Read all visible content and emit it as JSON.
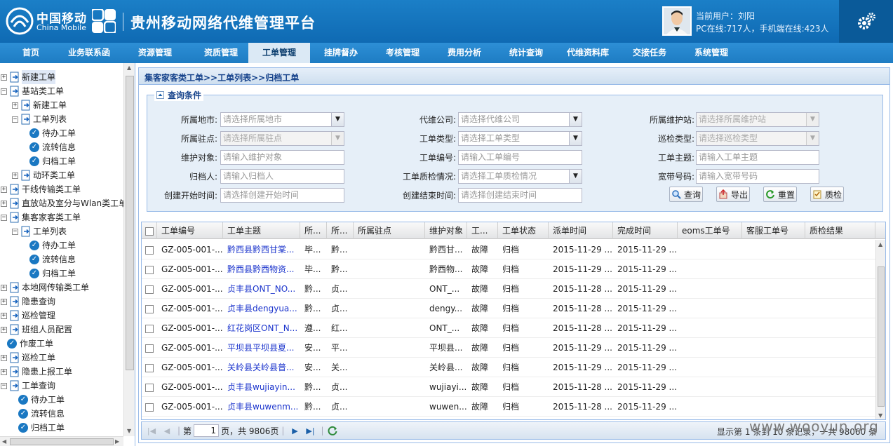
{
  "header": {
    "brand_cn": "中国移动",
    "brand_en": "China Mobile",
    "app_title": "贵州移动网络代维管理平台",
    "user_line1": "当前用户：刘阳",
    "user_line2": "PC在线:717人，手机端在线:423人"
  },
  "nav": [
    {
      "label": "首页"
    },
    {
      "label": "业务联系函"
    },
    {
      "label": "资源管理"
    },
    {
      "label": "资质管理"
    },
    {
      "label": "工单管理"
    },
    {
      "label": "挂牌督办"
    },
    {
      "label": "考核管理"
    },
    {
      "label": "费用分析"
    },
    {
      "label": "统计查询"
    },
    {
      "label": "代维资料库"
    },
    {
      "label": "交接任务"
    },
    {
      "label": "系统管理"
    }
  ],
  "tree": [
    {
      "label": "新建工单"
    },
    {
      "label": "基站类工单"
    },
    {
      "label": "新建工单"
    },
    {
      "label": "工单列表"
    },
    {
      "label": "待办工单"
    },
    {
      "label": "流转信息"
    },
    {
      "label": "归档工单"
    },
    {
      "label": "动环类工单"
    },
    {
      "label": "干线传输类工单"
    },
    {
      "label": "直放站及室分与Wlan类工单"
    },
    {
      "label": "集客家客类工单"
    },
    {
      "label": "工单列表"
    },
    {
      "label": "待办工单"
    },
    {
      "label": "流转信息"
    },
    {
      "label": "归档工单"
    },
    {
      "label": "本地网传输类工单"
    },
    {
      "label": "隐患查询"
    },
    {
      "label": "巡检管理"
    },
    {
      "label": "班组人员配置"
    },
    {
      "label": "作废工单"
    },
    {
      "label": "巡检工单"
    },
    {
      "label": "隐患上报工单"
    },
    {
      "label": "工单查询"
    },
    {
      "label": "待办工单"
    },
    {
      "label": "流转信息"
    },
    {
      "label": "归档工单"
    }
  ],
  "breadcrumb": "集客家客类工单>>工单列表>>归档工单",
  "query": {
    "title": "查询条件",
    "fields": [
      {
        "label": "所属地市:",
        "placeholder": "请选择所属地市"
      },
      {
        "label": "代维公司:",
        "placeholder": "请选择代维公司"
      },
      {
        "label": "所属维护站:",
        "placeholder": "请选择所属维护站"
      },
      {
        "label": "所属驻点:",
        "placeholder": "请选择所属驻点"
      },
      {
        "label": "工单类型:",
        "placeholder": "请选择工单类型"
      },
      {
        "label": "巡检类型:",
        "placeholder": "请选择巡检类型"
      },
      {
        "label": "维护对象:",
        "placeholder": "请输入维护对象"
      },
      {
        "label": "工单编号:",
        "placeholder": "请输入工单编号"
      },
      {
        "label": "工单主题:",
        "placeholder": "请输入工单主题"
      },
      {
        "label": "归档人:",
        "placeholder": "请输入归档人"
      },
      {
        "label": "工单质检情况:",
        "placeholder": "请选择工单质检情况"
      },
      {
        "label": "宽带号码:",
        "placeholder": "请输入宽带号码"
      },
      {
        "label": "创建开始时间:",
        "placeholder": "请选择创建开始时间"
      },
      {
        "label": "创建结束时间:",
        "placeholder": "请选择创建结束时间"
      }
    ],
    "buttons": {
      "search": "查询",
      "export": "导出",
      "reset": "重置",
      "qc": "质检"
    }
  },
  "grid": {
    "columns": [
      "工单编号",
      "工单主题",
      "所...",
      "所...",
      "所属驻点",
      "维护对象",
      "工...",
      "工单状态",
      "派单时间",
      "完成时间",
      "eoms工单号",
      "客服工单号",
      "质检结果"
    ],
    "rows": [
      [
        "GZ-005-001-...",
        "黔西县黔西甘棠...",
        "毕...",
        "黔...",
        "",
        "黔西甘...",
        "故障",
        "归档",
        "2015-11-29 ...",
        "2015-11-29 ...",
        "",
        "",
        ""
      ],
      [
        "GZ-005-001-...",
        "黔西县黔西物资...",
        "毕...",
        "黔...",
        "",
        "黔西物...",
        "故障",
        "归档",
        "2015-11-29 ...",
        "2015-11-29 ...",
        "",
        "",
        ""
      ],
      [
        "GZ-005-001-...",
        "贞丰县ONT_NO...",
        "黔...",
        "贞...",
        "",
        "ONT_...",
        "故障",
        "归档",
        "2015-11-28 ...",
        "2015-11-29 ...",
        "",
        "",
        ""
      ],
      [
        "GZ-005-001-...",
        "贞丰县dengyua...",
        "黔...",
        "贞...",
        "",
        "dengy...",
        "故障",
        "归档",
        "2015-11-28 ...",
        "2015-11-29 ...",
        "",
        "",
        ""
      ],
      [
        "GZ-005-001-...",
        "红花岗区ONT_N...",
        "遵...",
        "红...",
        "",
        "ONT_...",
        "故障",
        "归档",
        "2015-11-28 ...",
        "2015-11-29 ...",
        "",
        "",
        ""
      ],
      [
        "GZ-005-001-...",
        "平坝县平坝县夏...",
        "安...",
        "平...",
        "",
        "平坝县...",
        "故障",
        "归档",
        "2015-11-29 ...",
        "2015-11-29 ...",
        "",
        "",
        ""
      ],
      [
        "GZ-005-001-...",
        "关岭县关岭县普...",
        "安...",
        "关...",
        "",
        "关岭县...",
        "故障",
        "归档",
        "2015-11-29 ...",
        "2015-11-29 ...",
        "",
        "",
        ""
      ],
      [
        "GZ-005-001-...",
        "贞丰县wujiayin...",
        "黔...",
        "贞...",
        "",
        "wujiayi...",
        "故障",
        "归档",
        "2015-11-28 ...",
        "2015-11-29 ...",
        "",
        "",
        ""
      ],
      [
        "GZ-005-001-...",
        "贞丰县wuwenm...",
        "黔...",
        "贞...",
        "",
        "wuwen...",
        "故障",
        "归档",
        "2015-11-28 ...",
        "2015-11-29 ...",
        "",
        "",
        ""
      ]
    ]
  },
  "pager": {
    "page_prefix": "第",
    "page_value": "1",
    "page_suffix": "页，共 9806页",
    "status": "显示第 1 条到 10 条记录，一共 98060 条"
  },
  "watermark": "www.wooyun.org",
  "colors": {
    "brand_blue": "#1b7fc7",
    "nav_blue": "#2d8fd6",
    "panel_bg": "#e6eff8",
    "link": "#1a33cc"
  }
}
